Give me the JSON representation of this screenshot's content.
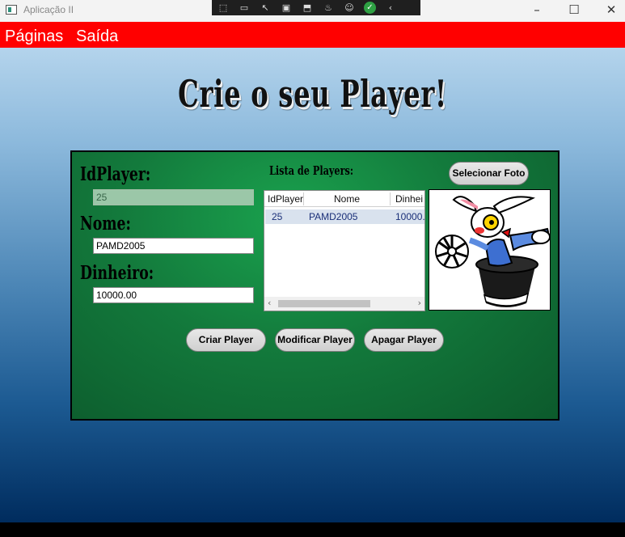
{
  "window": {
    "title": "Aplicação II",
    "controls": {
      "minimize": "–",
      "maximize": "☐",
      "close": "✕"
    }
  },
  "debug_toolbar": {
    "icons": [
      "select-element-icon",
      "camera-icon",
      "pointer-icon",
      "frame-icon",
      "adorner-icon",
      "hot-reload-icon",
      "accessibility-icon",
      "checkmark-icon",
      "collapse-chevron-icon"
    ]
  },
  "menu": {
    "items": [
      "Páginas",
      "Saída"
    ]
  },
  "page": {
    "title": "Crie o seu Player!"
  },
  "form": {
    "id_label": "IdPlayer:",
    "id_value": "25",
    "name_label": "Nome:",
    "name_value": "PAMD2005",
    "money_label": "Dinheiro:",
    "money_value": "10000.00"
  },
  "list": {
    "title": "Lista de Players:",
    "columns": [
      "IdPlayer",
      "Nome",
      "Dinhei"
    ],
    "rows": [
      {
        "id": "25",
        "nome": "PAMD2005",
        "dinheiro": "10000."
      }
    ]
  },
  "buttons": {
    "select_photo": "Selecionar Foto",
    "create": "Criar Player",
    "modify": "Modificar Player",
    "delete": "Apagar Player"
  },
  "colors": {
    "menu_bar": "#ff0000",
    "panel_green": "#137a3c",
    "selected_row": "#d9e2ee"
  }
}
